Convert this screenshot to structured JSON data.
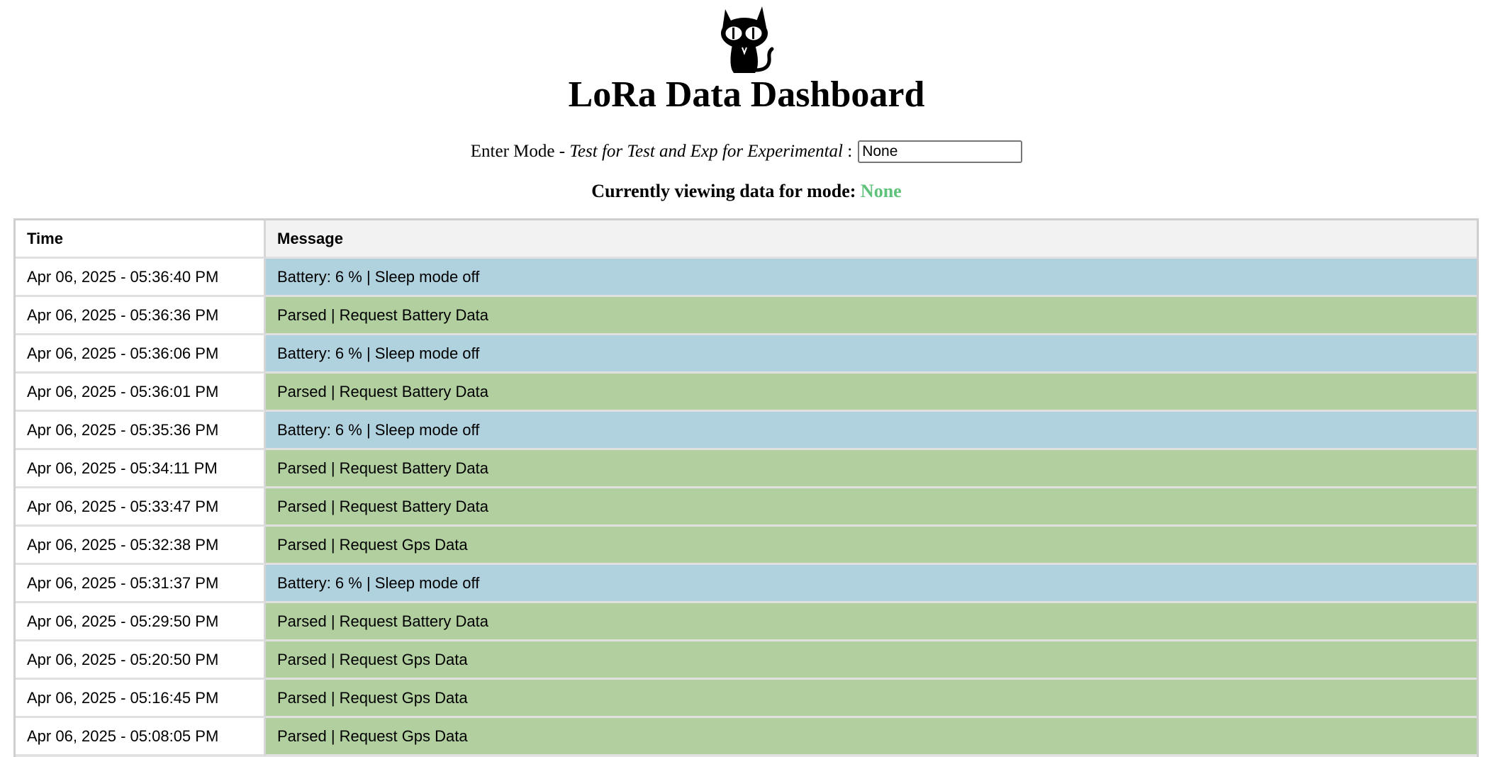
{
  "header": {
    "title": "LoRa Data Dashboard",
    "logo_icon": "black-cat-icon"
  },
  "mode_input": {
    "lead": "Enter Mode - ",
    "hint": "Test for Test and Exp for Experimental",
    "sep": " :",
    "value": "None"
  },
  "current_mode": {
    "label": "Currently viewing data for mode: ",
    "value": "None",
    "value_color": "#5ec27a"
  },
  "table": {
    "headers": {
      "time": "Time",
      "message": "Message"
    },
    "rows": [
      {
        "time": "Apr 06, 2025 - 05:36:40 PM",
        "message": "Battery: 6 % | Sleep mode off",
        "kind": "battery"
      },
      {
        "time": "Apr 06, 2025 - 05:36:36 PM",
        "message": "Parsed | Request Battery Data",
        "kind": "parsed"
      },
      {
        "time": "Apr 06, 2025 - 05:36:06 PM",
        "message": "Battery: 6 % | Sleep mode off",
        "kind": "battery"
      },
      {
        "time": "Apr 06, 2025 - 05:36:01 PM",
        "message": "Parsed | Request Battery Data",
        "kind": "parsed"
      },
      {
        "time": "Apr 06, 2025 - 05:35:36 PM",
        "message": "Battery: 6 % | Sleep mode off",
        "kind": "battery"
      },
      {
        "time": "Apr 06, 2025 - 05:34:11 PM",
        "message": "Parsed | Request Battery Data",
        "kind": "parsed"
      },
      {
        "time": "Apr 06, 2025 - 05:33:47 PM",
        "message": "Parsed | Request Battery Data",
        "kind": "parsed"
      },
      {
        "time": "Apr 06, 2025 - 05:32:38 PM",
        "message": "Parsed | Request Gps Data",
        "kind": "parsed"
      },
      {
        "time": "Apr 06, 2025 - 05:31:37 PM",
        "message": "Battery: 6 % | Sleep mode off",
        "kind": "battery"
      },
      {
        "time": "Apr 06, 2025 - 05:29:50 PM",
        "message": "Parsed | Request Battery Data",
        "kind": "parsed"
      },
      {
        "time": "Apr 06, 2025 - 05:20:50 PM",
        "message": "Parsed | Request Gps Data",
        "kind": "parsed"
      },
      {
        "time": "Apr 06, 2025 - 05:16:45 PM",
        "message": "Parsed | Request Gps Data",
        "kind": "parsed"
      },
      {
        "time": "Apr 06, 2025 - 05:08:05 PM",
        "message": "Parsed | Request Gps Data",
        "kind": "parsed"
      }
    ]
  },
  "colors": {
    "battery_row": "#b0d1de",
    "parsed_row": "#b2cfa0",
    "header_bg": "#f2f2f2"
  }
}
